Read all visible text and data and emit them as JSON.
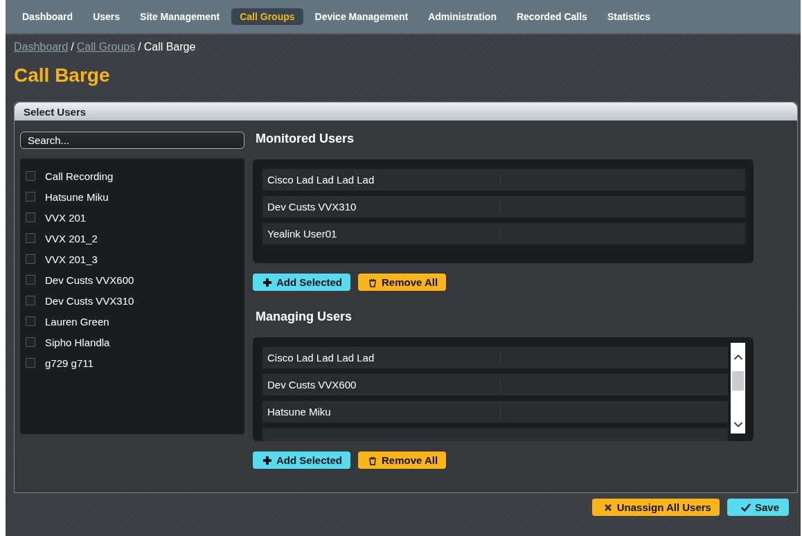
{
  "nav": [
    {
      "label": "Dashboard",
      "selected": false
    },
    {
      "label": "Users",
      "selected": false
    },
    {
      "label": "Site Management",
      "selected": false
    },
    {
      "label": "Call Groups",
      "selected": true
    },
    {
      "label": "Device Management",
      "selected": false
    },
    {
      "label": "Administration",
      "selected": false
    },
    {
      "label": "Recorded Calls",
      "selected": false
    },
    {
      "label": "Statistics",
      "selected": false
    }
  ],
  "breadcrumb": [
    {
      "label": "Dashboard",
      "kind": "link"
    },
    {
      "label": "/",
      "kind": "separator"
    },
    {
      "label": "Call Groups",
      "kind": "link"
    },
    {
      "label": "/",
      "kind": "separator"
    },
    {
      "label": "Call Barge",
      "kind": "current"
    }
  ],
  "title": "Call Barge",
  "panel": {
    "title": "Select Users",
    "search": {
      "placeholder": "Search..."
    },
    "users": [
      {
        "name": "Call Recording",
        "checked": false
      },
      {
        "name": "Hatsune Miku",
        "checked": false
      },
      {
        "name": "VVX 201",
        "checked": false
      },
      {
        "name": "VVX 201_2",
        "checked": false
      },
      {
        "name": "VVX 201_3",
        "checked": false
      },
      {
        "name": "Dev Custs VVX600",
        "checked": false
      },
      {
        "name": "Dev Custs VVX310",
        "checked": false
      },
      {
        "name": "Lauren Green",
        "checked": false
      },
      {
        "name": "Sipho Hlandla",
        "checked": false
      },
      {
        "name": "g729 g711",
        "checked": false
      }
    ],
    "sections": [
      {
        "title": "Monitored Users",
        "scrollable": false,
        "rows": [
          "Cisco Lad Lad Lad Lad",
          "Dev Custs VVX310",
          "Yealink User01"
        ],
        "add_label": "Add Selected",
        "remove_label": "Remove All"
      },
      {
        "title": "Managing Users",
        "scrollable": true,
        "rows": [
          "Cisco Lad Lad Lad Lad",
          "Dev Custs VVX600",
          "Hatsune Miku"
        ],
        "add_label": "Add Selected",
        "remove_label": "Remove All"
      }
    ]
  },
  "footer": {
    "unassign_label": "Unassign All Users",
    "save_label": "Save"
  }
}
